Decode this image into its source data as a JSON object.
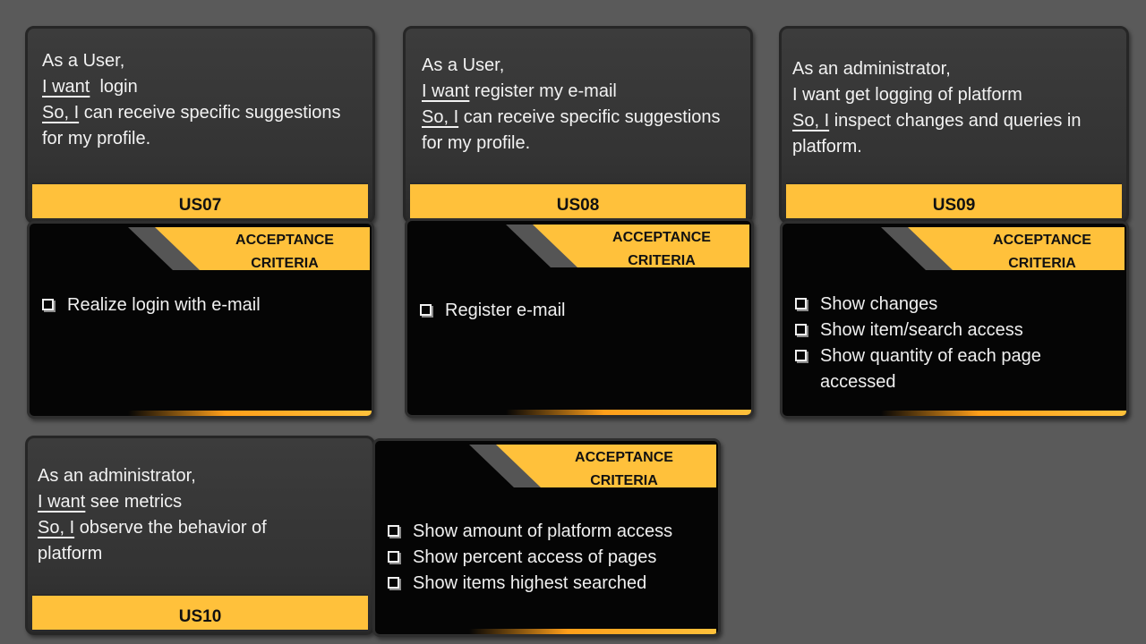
{
  "stories": [
    {
      "id": "US07",
      "lines": [
        {
          "keyword": "",
          "text": "As a User,"
        },
        {
          "keyword": "I want",
          "text": "  login"
        },
        {
          "keyword": "So, I",
          "text": " can receive specific suggestions for my profile."
        }
      ],
      "criteria_title": "ACCEPTANCE CRITERIA",
      "criteria": [
        "Realize login with e-mail"
      ]
    },
    {
      "id": "US08",
      "lines": [
        {
          "keyword": "",
          "text": "As a User,"
        },
        {
          "keyword": "I want",
          "text": " register my e-mail"
        },
        {
          "keyword": "So, I",
          "text": " can receive specific suggestions for my profile."
        }
      ],
      "criteria_title": "ACCEPTANCE CRITERIA",
      "criteria": [
        "Register e-mail"
      ]
    },
    {
      "id": "US09",
      "lines": [
        {
          "keyword": "",
          "text": "As an administrator,"
        },
        {
          "keyword": "",
          "text": "I want get logging of platform"
        },
        {
          "keyword": "So, I",
          "text": " inspect changes and queries in platform."
        }
      ],
      "criteria_title": "ACCEPTANCE CRITERIA",
      "criteria": [
        "Show changes",
        "Show item/search access",
        "Show quantity of each page accessed"
      ]
    },
    {
      "id": "US10",
      "lines": [
        {
          "keyword": "",
          "text": "As an administrator,"
        },
        {
          "keyword": "I want",
          "text": " see metrics"
        },
        {
          "keyword": "So, I",
          "text": " observe the behavior of platform"
        }
      ],
      "criteria_title": "ACCEPTANCE CRITERIA",
      "criteria": [
        "Show amount of platform access",
        "Show percent access of pages",
        "Show items highest searched"
      ]
    }
  ],
  "colors": {
    "background": "#5a5a5a",
    "card": "#383838",
    "accent": "#ffc13b",
    "criteria_panel": "#050505"
  },
  "icons": {
    "criteria_bullet": "checkbox-icon"
  }
}
